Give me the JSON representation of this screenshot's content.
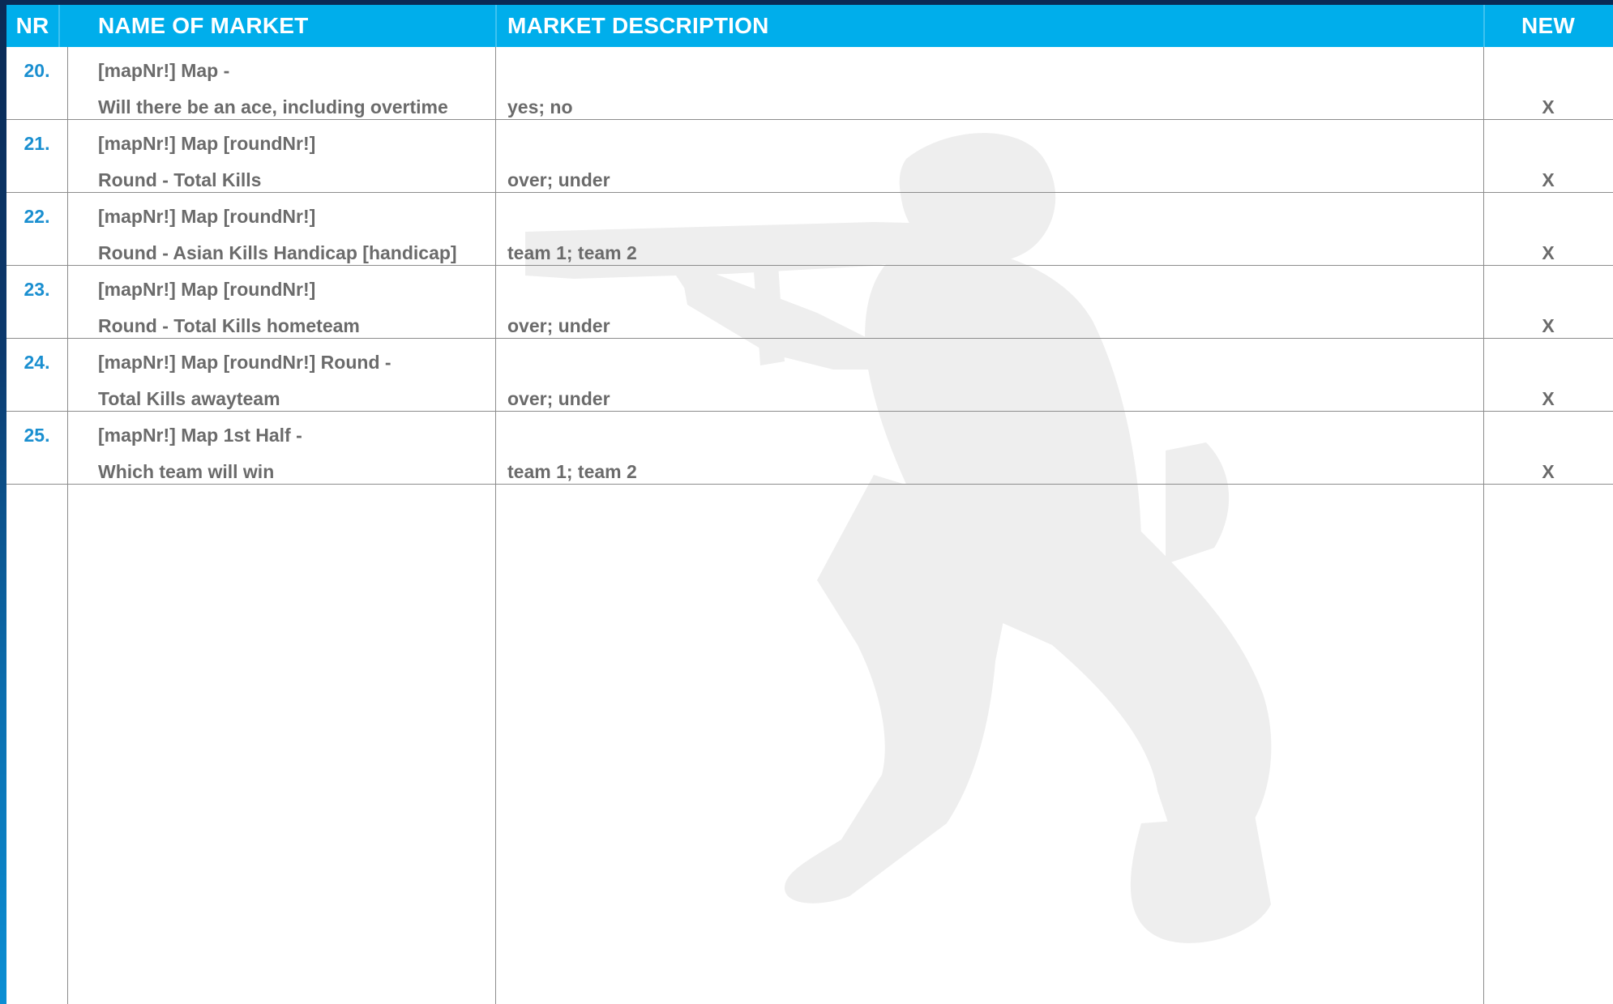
{
  "table": {
    "headers": {
      "nr": "NR",
      "name": "NAME OF MARKET",
      "description": "MARKET DESCRIPTION",
      "new": "NEW"
    },
    "rows": [
      {
        "nr": "20.",
        "name_line1": "[mapNr!] Map -",
        "name_line2": "Will there be an ace, including overtime",
        "description": "yes; no",
        "new": "X"
      },
      {
        "nr": "21.",
        "name_line1": "[mapNr!] Map [roundNr!]",
        "name_line2": "Round - Total Kills",
        "description": "over; under",
        "new": "X"
      },
      {
        "nr": "22.",
        "name_line1": "[mapNr!] Map [roundNr!]",
        "name_line2": "Round - Asian Kills Handicap [handicap]",
        "description": "team 1; team 2",
        "new": "X"
      },
      {
        "nr": "23.",
        "name_line1": "[mapNr!] Map [roundNr!]",
        "name_line2": "Round - Total Kills hometeam",
        "description": "over; under",
        "new": "X"
      },
      {
        "nr": "24.",
        "name_line1": "[mapNr!] Map [roundNr!] Round -",
        "name_line2": "Total Kills awayteam",
        "description": "over; under",
        "new": "X"
      },
      {
        "nr": "25.",
        "name_line1": "[mapNr!] Map 1st Half -",
        "name_line2": "Which team will win",
        "description": "team 1; team 2",
        "new": "X"
      }
    ]
  },
  "colors": {
    "header_bg": "#00aeeb",
    "header_text": "#ffffff",
    "number_text": "#1a8fd0",
    "cell_text": "#6b6b6b",
    "watermark": "#eeeeee"
  },
  "icons": {
    "watermark": "kneeling-soldier-silhouette"
  }
}
